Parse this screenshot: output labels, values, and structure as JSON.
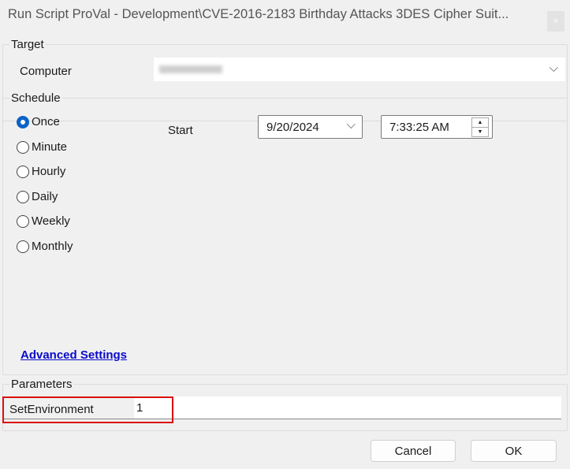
{
  "window": {
    "title": "Run Script ProVal - Development\\CVE-2016-2183 Birthday Attacks 3DES Cipher Suit...",
    "close": "×"
  },
  "target": {
    "legend": "Target",
    "computer_label": "Computer"
  },
  "schedule": {
    "legend": "Schedule",
    "options": [
      "Once",
      "Minute",
      "Hourly",
      "Daily",
      "Weekly",
      "Monthly"
    ],
    "selected": "Once",
    "start_label": "Start",
    "date": "9/20/2024",
    "time": "7:33:25 AM"
  },
  "advanced_settings": "Advanced Settings",
  "parameters": {
    "legend": "Parameters",
    "rows": [
      {
        "name": "SetEnvironment",
        "value": "1"
      }
    ]
  },
  "buttons": {
    "cancel": "Cancel",
    "ok": "OK"
  }
}
